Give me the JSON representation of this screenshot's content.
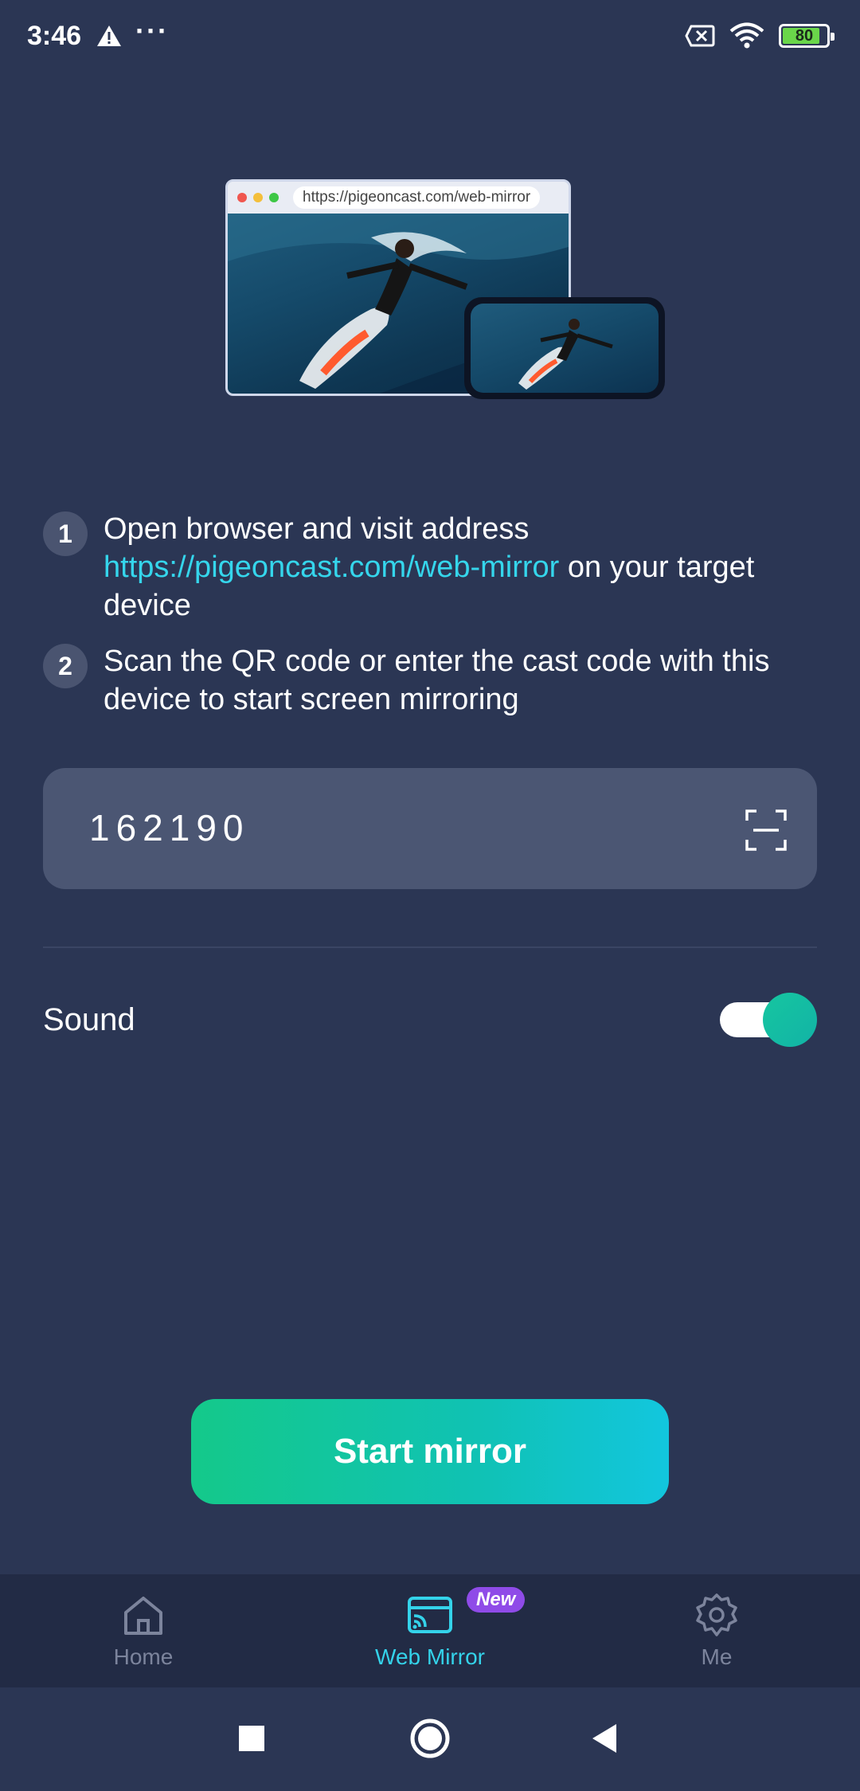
{
  "status_bar": {
    "time": "3:46",
    "battery": "80",
    "icons": [
      "warning-icon",
      "more-dots-icon",
      "no-sim-icon",
      "wifi-icon",
      "battery-icon"
    ]
  },
  "illustration": {
    "url": "https://pigeoncast.com/web-mirror"
  },
  "steps": [
    {
      "number": "1",
      "text_before": "Open browser and visit address ",
      "link": "https://pigeoncast.com/web-mirror",
      "text_after": " on your target device"
    },
    {
      "number": "2",
      "text": "Scan the QR code or enter the cast code with this device to start screen mirroring"
    }
  ],
  "cast_code": {
    "value": "162190",
    "scan_icon": "scan-qr-icon"
  },
  "sound": {
    "label": "Sound",
    "enabled": true
  },
  "start_button": {
    "label": "Start mirror"
  },
  "bottom_nav": {
    "items": [
      {
        "label": "Home",
        "icon": "home-icon",
        "active": false
      },
      {
        "label": "Web Mirror",
        "icon": "cast-icon",
        "active": true,
        "badge": "New"
      },
      {
        "label": "Me",
        "icon": "gear-icon",
        "active": false
      }
    ]
  },
  "colors": {
    "background": "#2b3654",
    "accent": "#34d3ea",
    "button_start": "#14c98a",
    "button_end": "#12c6de",
    "badge": "#8f4be8"
  }
}
